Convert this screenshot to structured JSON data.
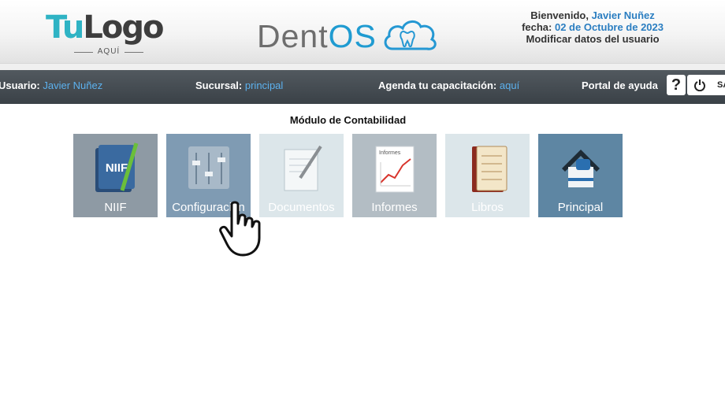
{
  "logo": {
    "brand_main_a": "Tu",
    "brand_main_b": "Logo",
    "brand_sub": "AQUÍ"
  },
  "app": {
    "name_a": "Dent",
    "name_b": "OS"
  },
  "welcome": {
    "greeting_label": "Bienvenido,",
    "user_name": "Javier Nuñez",
    "date_label": "fecha:",
    "date_value": "02 de Octubre de 2023",
    "edit_user_link": "Modificar datos del usuario"
  },
  "userbar": {
    "user_label": "Usuario:",
    "user_value": "Javier Nuñez",
    "branch_label": "Sucursal:",
    "branch_value": "principal",
    "training_label": "Agenda tu capacitación:",
    "training_link": "aquí",
    "help_label": "Portal de ayuda",
    "help_button": "?",
    "exit_label": "SA"
  },
  "module": {
    "title": "Módulo de Contabilidad",
    "tiles": [
      {
        "label": "NIIF",
        "icon": "niif-book-icon",
        "bg": "#8e9aa4"
      },
      {
        "label": "Configuración",
        "icon": "configuration-sliders-icon",
        "bg": "#7f9bb3"
      },
      {
        "label": "Documentos",
        "icon": "document-pen-icon",
        "bg": "#dce6ea"
      },
      {
        "label": "Informes",
        "icon": "report-chart-icon",
        "bg": "#b3bdc4"
      },
      {
        "label": "Libros",
        "icon": "ledger-book-icon",
        "bg": "#dce6ea"
      },
      {
        "label": "Principal",
        "icon": "home-house-icon",
        "bg": "#5e86a3"
      }
    ]
  },
  "icon_text": {
    "niif": "NIIF",
    "informes": "Informes"
  },
  "colors": {
    "accent_blue": "#2b7ec1",
    "link_light_blue": "#5cb1ee",
    "bar_dark": "#3a4147",
    "brand_teal": "#2fb3c4"
  }
}
